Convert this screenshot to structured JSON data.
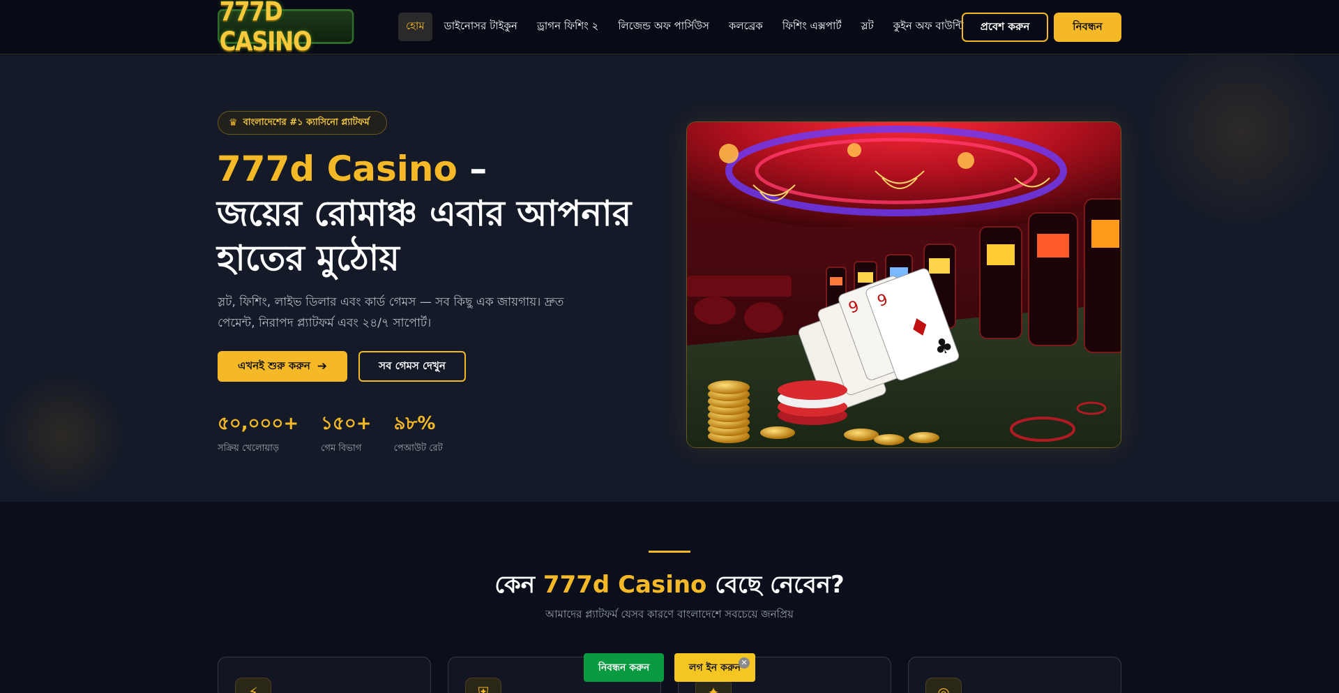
{
  "header": {
    "logo_text": "777D CASINO",
    "nav": [
      {
        "label": "হোম",
        "active": true
      },
      {
        "label": "ডাইনোসর টাইকুন"
      },
      {
        "label": "ড্রাগন ফিশিং ২"
      },
      {
        "label": "লিজেন্ড অফ পার্সিউস"
      },
      {
        "label": "কলব্রেক"
      },
      {
        "label": "ফিশিং এক্সপার্ট"
      },
      {
        "label": "স্লট"
      },
      {
        "label": "কুইন অফ বাউন্টি"
      }
    ],
    "login_label": "প্রবেশ করুন",
    "register_label": "নিবন্ধন"
  },
  "hero": {
    "badge_icon": "crown-icon",
    "badge_text": "বাংলাদেশের #১ ক্যাসিনো প্ল্যাটফর্ম",
    "title_accent": "777d Casino",
    "title_dash": " –",
    "title_line2": "জয়ের রোমাঞ্চ এবার আপনার",
    "title_line3": "হাতের মুঠোয়",
    "description": "স্লট, ফিশিং, লাইভ ডিলার এবং কার্ড গেমস — সব কিছু এক জায়গায়। দ্রুত পেমেন্ট, নিরাপদ প্ল্যাটফর্ম এবং ২৪/৭ সাপোর্ট।",
    "start_button": "এখনই শুরু করুন",
    "start_icon": "arrow-right-icon",
    "games_button": "সব গেমস দেখুন",
    "stats": [
      {
        "value": "৫০,০০০+",
        "label": "সক্রিয় খেলোয়াড়"
      },
      {
        "value": "১৫০+",
        "label": "গেম বিভাগ"
      },
      {
        "value": "৯৮%",
        "label": "পেআউট রেট"
      }
    ],
    "image_icon": "casino-interior-image"
  },
  "why": {
    "title_prefix": "কেন ",
    "title_accent": "777d Casino",
    "title_suffix": " বেছে নেবেন?",
    "subtitle": "আমাদের প্ল্যাটফর্ম যেসব কারণে বাংলাদেশে সবচেয়ে জনপ্রিয়",
    "cards": [
      {
        "icon": "bolt-icon"
      },
      {
        "icon": "shield-icon"
      },
      {
        "icon": "gift-icon"
      },
      {
        "icon": "support-icon"
      }
    ]
  },
  "floating": {
    "register_label": "নিবন্ধন করুন",
    "login_label": "লগ ইন করুন",
    "close_icon": "close-icon"
  },
  "colors": {
    "accent": "#f5b927",
    "background": "#0b0f1c",
    "hero_bg": "#141a28",
    "float_register": "#0a9a3f",
    "float_login": "#f5c523"
  }
}
